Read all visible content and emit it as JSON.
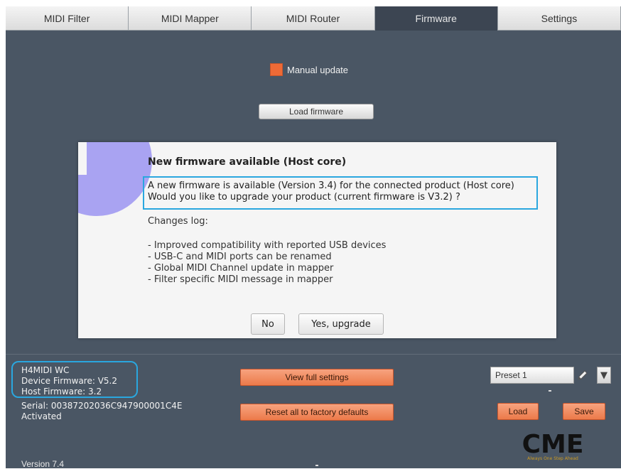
{
  "tabs": [
    {
      "label": "MIDI Filter",
      "active": false
    },
    {
      "label": "MIDI Mapper",
      "active": false
    },
    {
      "label": "MIDI Router",
      "active": false
    },
    {
      "label": "Firmware",
      "active": true
    },
    {
      "label": "Settings",
      "active": false
    }
  ],
  "firmware": {
    "manual_update_label": "Manual update",
    "manual_update_checked": true,
    "load_firmware_label": "Load firmware"
  },
  "dialog": {
    "title": "New firmware available (Host core)",
    "message_line1": "A new firmware is available (Version 3.4) for the connected product (Host core)",
    "message_line2": "Would you like to upgrade your product (current firmware is V3.2) ?",
    "changes_title": "Changes log:",
    "changes": [
      "- Improved compatibility with reported USB devices",
      "- USB-C and MIDI ports can be renamed",
      "- Global MIDI Channel update in mapper",
      "- Filter specific MIDI message in mapper"
    ],
    "no_label": "No",
    "yes_label": "Yes, upgrade",
    "icon": "info-icon",
    "icon_color": "#a9a3f2"
  },
  "device": {
    "name": "H4MIDI WC",
    "device_firmware": "Device Firmware: V5.2",
    "host_firmware": "Host Firmware: 3.2",
    "serial": "Serial: 00387202036C947900001C4E",
    "status": "Activated"
  },
  "actions": {
    "view_full_settings": "View full settings",
    "reset_defaults": "Reset all to factory defaults"
  },
  "preset": {
    "selected": "Preset 1",
    "load_label": "Load",
    "save_label": "Save"
  },
  "brand": {
    "logo_text": "CME",
    "tagline": "Always One Step Ahead"
  },
  "app_version": "Version 7.4",
  "colors": {
    "background": "#4a5664",
    "accent_orange": "#ee6a36",
    "highlight_blue": "#2aa7df"
  }
}
